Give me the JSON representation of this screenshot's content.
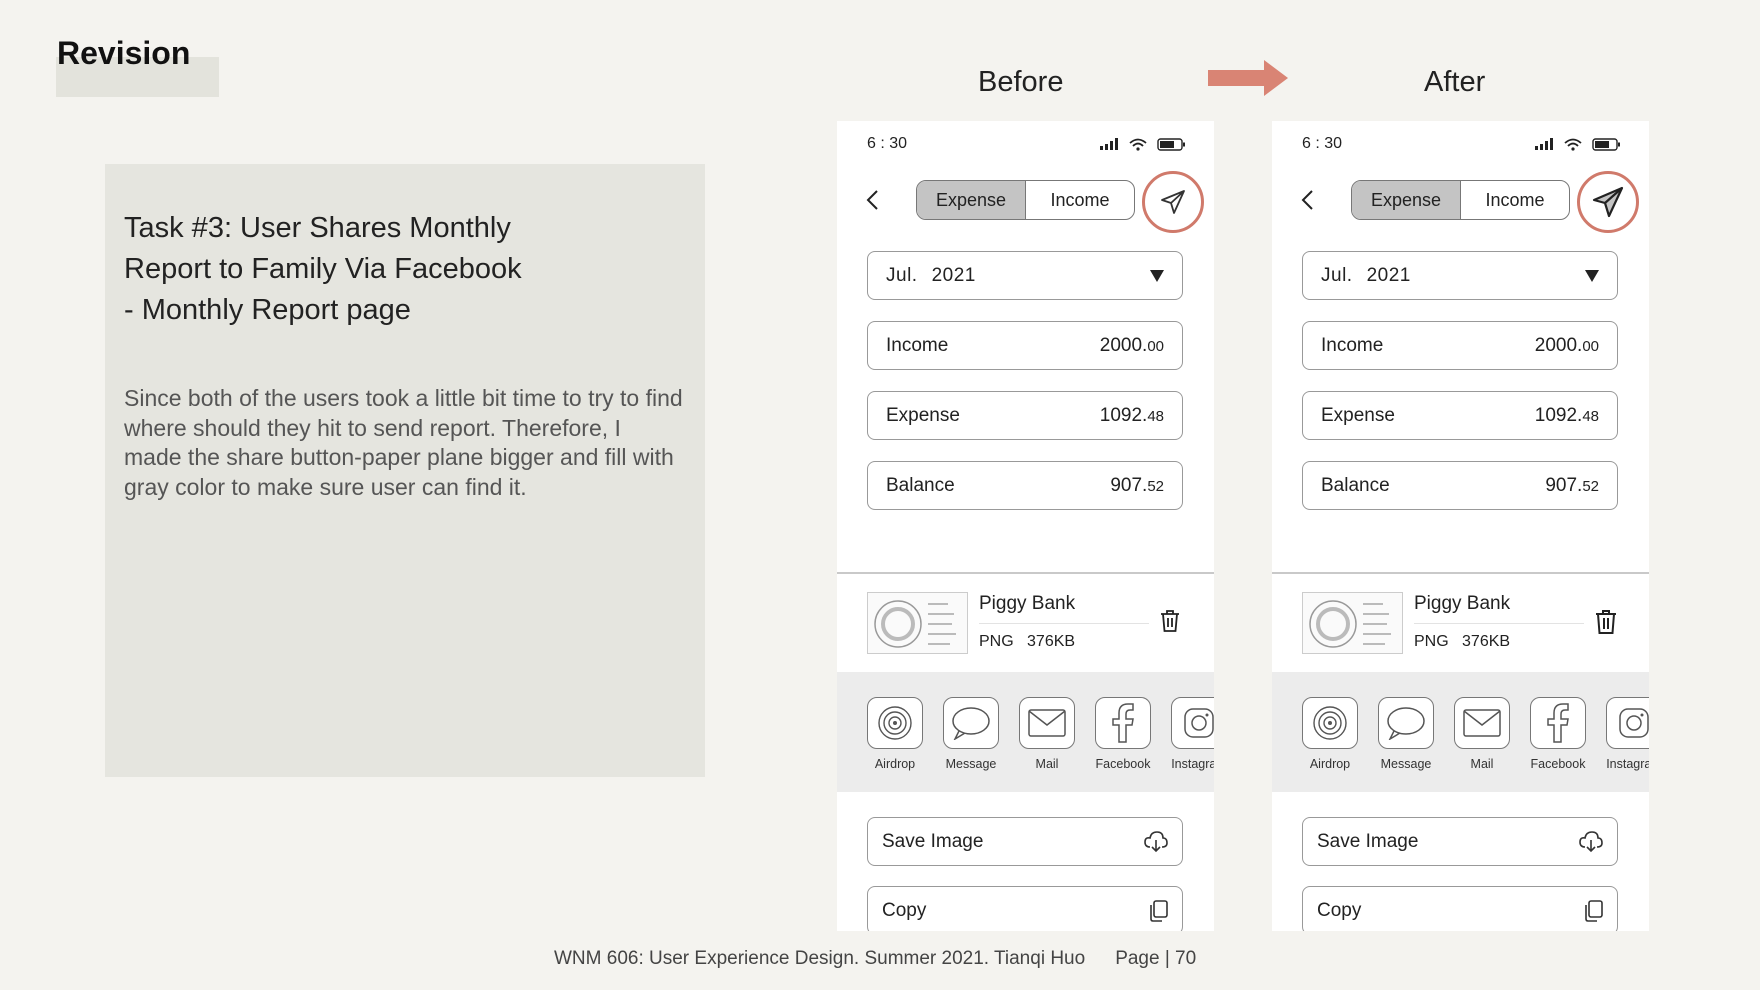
{
  "slide": {
    "title": "Revision",
    "before_label": "Before",
    "after_label": "After",
    "accent_color": "#d98474",
    "task_heading": [
      "Task #3: User Shares Monthly",
      "Report to Family Via Facebook",
      "- Monthly Report page"
    ],
    "task_body": "Since both of the users took a little bit time to try to find where should they hit to send report. Therefore, I made the share button-paper plane bigger and fill with gray color to make sure user can find it.",
    "footer_text": "WNM 606: User Experience Design. Summer 2021. Tianqi Huo",
    "footer_page": "Page | 70"
  },
  "phone": {
    "time": "6 : 30",
    "segments": [
      "Expense",
      "Income"
    ],
    "active_segment": "Expense",
    "month": "Jul.",
    "year": "2021",
    "fields": [
      {
        "label": "Income",
        "int": "2000.",
        "dec": "00"
      },
      {
        "label": "Expense",
        "int": "1092.",
        "dec": "48"
      },
      {
        "label": "Balance",
        "int": "907.",
        "dec": "52"
      }
    ],
    "attachment": {
      "name": "Piggy Bank",
      "type": "PNG",
      "size": "376KB"
    },
    "share_apps": [
      {
        "label": "Airdrop",
        "icon": "airdrop-icon"
      },
      {
        "label": "Message",
        "icon": "message-icon"
      },
      {
        "label": "Mail",
        "icon": "mail-icon"
      },
      {
        "label": "Facebook",
        "icon": "facebook-icon"
      },
      {
        "label": "Instagram",
        "icon": "instagram-icon"
      }
    ],
    "actions": [
      {
        "label": "Save Image",
        "icon": "cloud-download-icon"
      },
      {
        "label": "Copy",
        "icon": "copy-icon"
      }
    ]
  }
}
